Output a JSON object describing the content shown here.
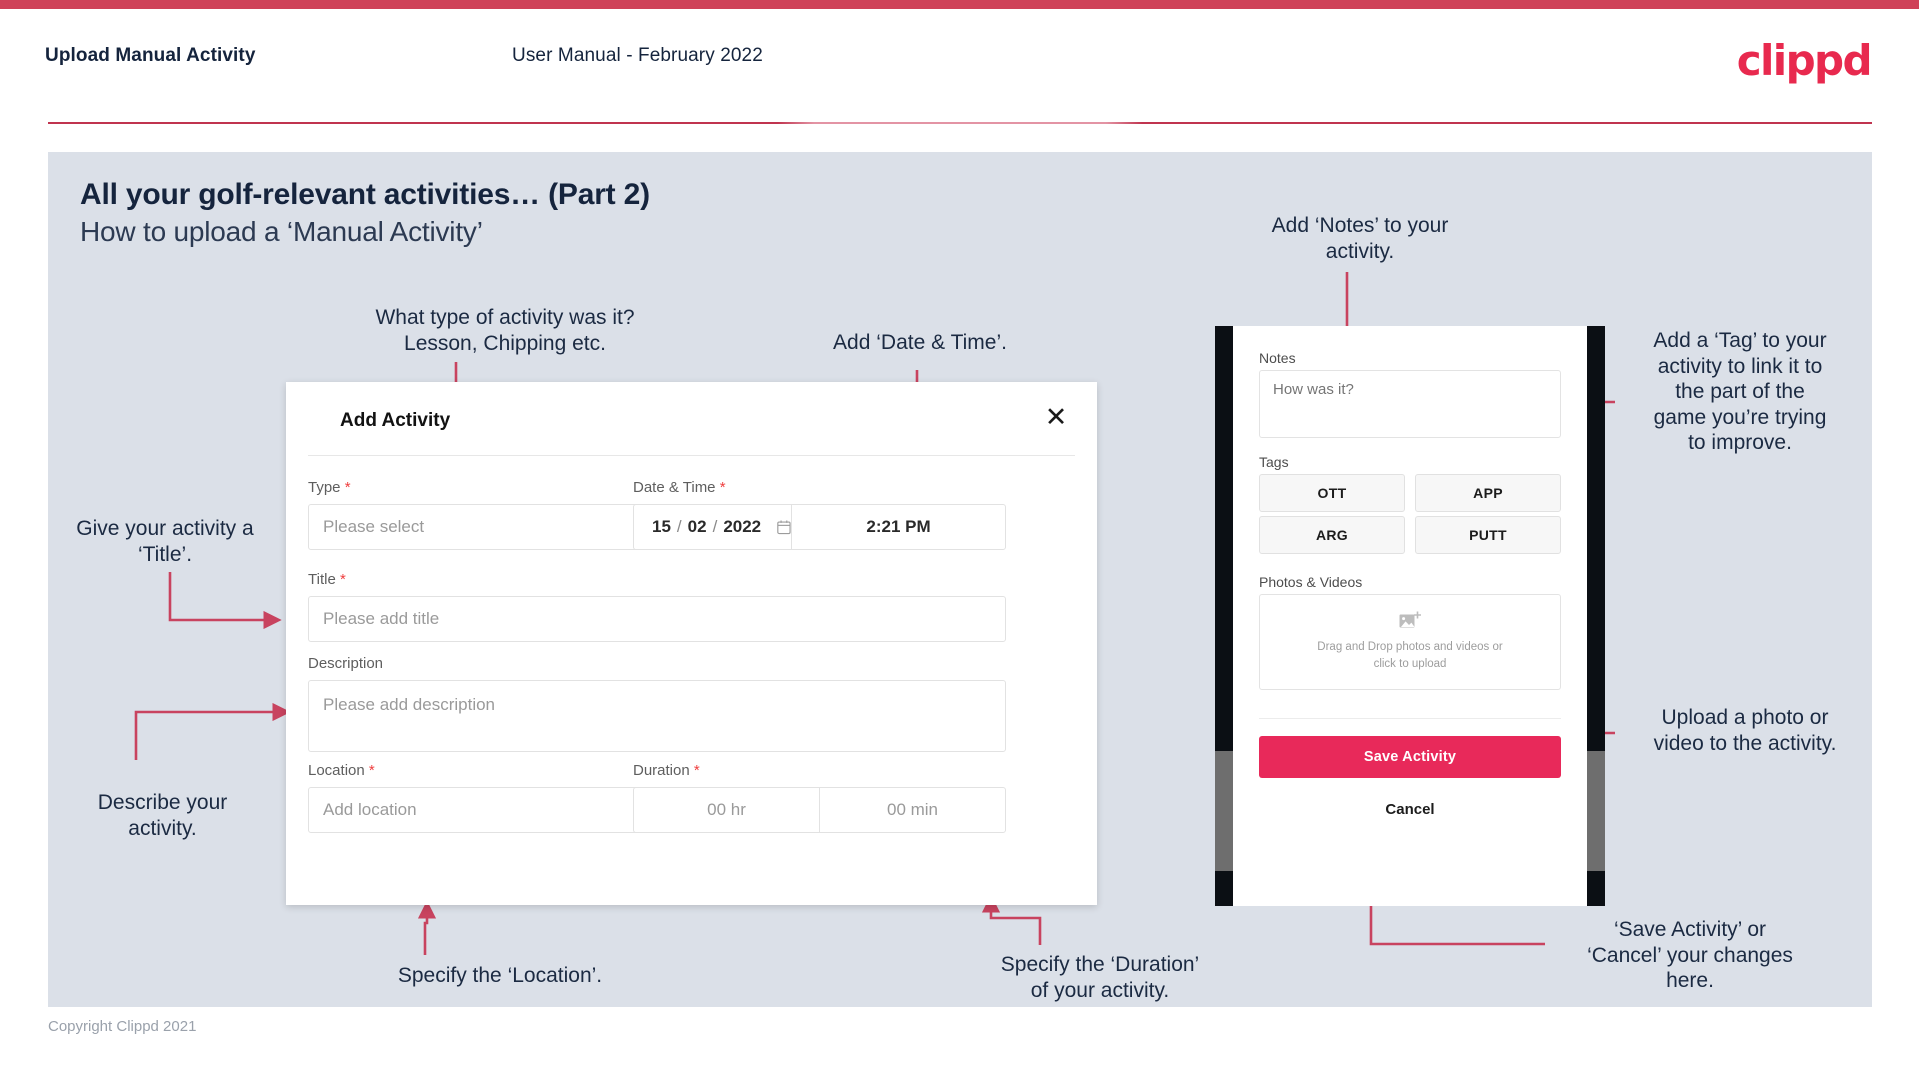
{
  "header": {
    "title": "Upload Manual Activity",
    "subtitle": "User Manual - February 2022",
    "logo": "clippd"
  },
  "slide": {
    "title": "All your golf-relevant activities… (Part 2)",
    "subtitle": "How to upload a ‘Manual Activity’"
  },
  "annotations": {
    "type": "What type of activity was it?\nLesson, Chipping etc.",
    "datetime": "Add ‘Date & Time’.",
    "title_field": "Give your activity a\n‘Title’.",
    "description": "Describe your\nactivity.",
    "location": "Specify the ‘Location’.",
    "duration": "Specify the ‘Duration’\nof your activity.",
    "notes": "Add ‘Notes’ to your\nactivity.",
    "tags": "Add a ‘Tag’ to your\nactivity to link it to\nthe part of the\ngame you’re trying\nto improve.",
    "photos": "Upload a photo or\nvideo to the activity.",
    "save_cancel": "‘Save Activity’ or\n‘Cancel’ your changes\nhere."
  },
  "dialog": {
    "title": "Add Activity",
    "close_icon": "close-icon",
    "fields": {
      "type": {
        "label": "Type",
        "required": "*",
        "placeholder": "Please select",
        "value": "",
        "caret_icon": "chevron-down-icon"
      },
      "datetime": {
        "label": "Date & Time",
        "required": "*",
        "day": "15",
        "sep1": "/",
        "month": "02",
        "sep2": "/",
        "year": "2022",
        "calendar_icon": "calendar-icon",
        "time": "2:21 PM"
      },
      "title": {
        "label": "Title",
        "required": "*",
        "placeholder": "Please add title",
        "value": ""
      },
      "description": {
        "label": "Description",
        "required": "",
        "placeholder": "Please add description",
        "value": ""
      },
      "location": {
        "label": "Location",
        "required": "*",
        "placeholder": "Add location",
        "value": ""
      },
      "duration": {
        "label": "Duration",
        "required": "*",
        "hours_placeholder": "00 hr",
        "minutes_placeholder": "00 min"
      }
    }
  },
  "phone": {
    "notes": {
      "label": "Notes",
      "placeholder": "How was it?"
    },
    "tags": {
      "label": "Tags",
      "items": [
        "OTT",
        "APP",
        "ARG",
        "PUTT"
      ]
    },
    "photos": {
      "label": "Photos & Videos",
      "icon": "add-image-icon",
      "dropzone_text": "Drag and Drop photos and videos or click to upload"
    },
    "save_label": "Save Activity",
    "cancel_label": "Cancel"
  },
  "footer": {
    "copyright": "Copyright Clippd 2021"
  },
  "colors": {
    "brand_red": "#e8295a",
    "header_bar": "#cf4259",
    "slide_bg": "#dbe0e8",
    "text_dark": "#15243d",
    "connector": "#c8435f"
  }
}
